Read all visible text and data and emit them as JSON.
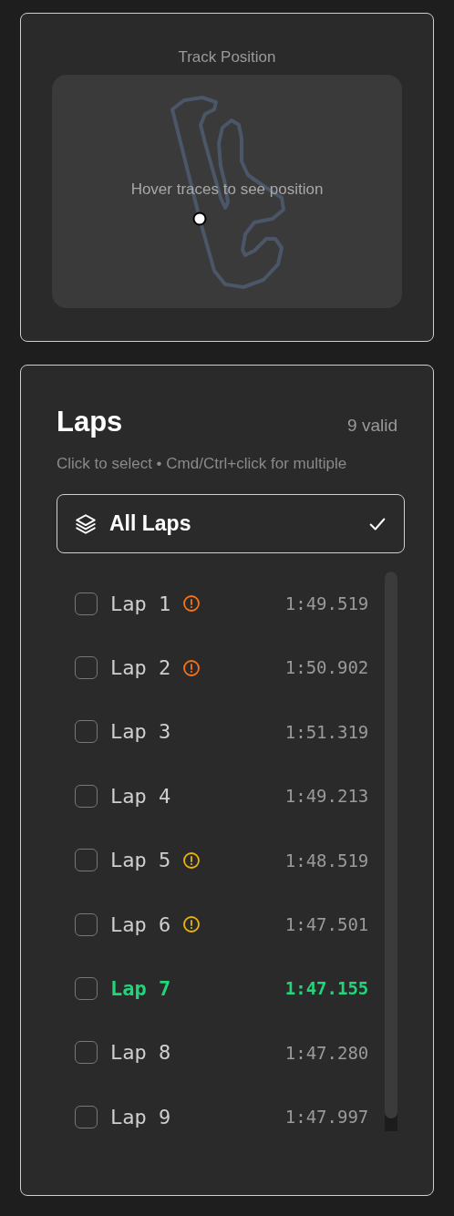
{
  "track_panel": {
    "title": "Track Position",
    "hint": "Hover traces to see position"
  },
  "laps_panel": {
    "title": "Laps",
    "valid_count": "9 valid",
    "instructions": "Click to select • Cmd/Ctrl+click for multiple",
    "all_laps": {
      "label": "All Laps",
      "selected": true
    },
    "laps": [
      {
        "label": "Lap 1",
        "time": "1:49.519",
        "checked": false,
        "best": false,
        "warning": true,
        "color": "#f97316"
      },
      {
        "label": "Lap 2",
        "time": "1:50.902",
        "checked": false,
        "best": false,
        "warning": true,
        "color": "#f97316"
      },
      {
        "label": "Lap 3",
        "time": "1:51.319",
        "checked": false,
        "best": false,
        "warning": false
      },
      {
        "label": "Lap 4",
        "time": "1:49.213",
        "checked": false,
        "best": false,
        "warning": false
      },
      {
        "label": "Lap 5",
        "time": "1:48.519",
        "checked": false,
        "best": false,
        "warning": true,
        "color": "#eab308"
      },
      {
        "label": "Lap 6",
        "time": "1:47.501",
        "checked": false,
        "best": false,
        "warning": true,
        "color": "#eab308"
      },
      {
        "label": "Lap 7",
        "time": "1:47.155",
        "checked": false,
        "best": true,
        "warning": false
      },
      {
        "label": "Lap 8",
        "time": "1:47.280",
        "checked": false,
        "best": false,
        "warning": false
      },
      {
        "label": "Lap 9",
        "time": "1:47.997",
        "checked": false,
        "best": false,
        "warning": false
      }
    ]
  }
}
